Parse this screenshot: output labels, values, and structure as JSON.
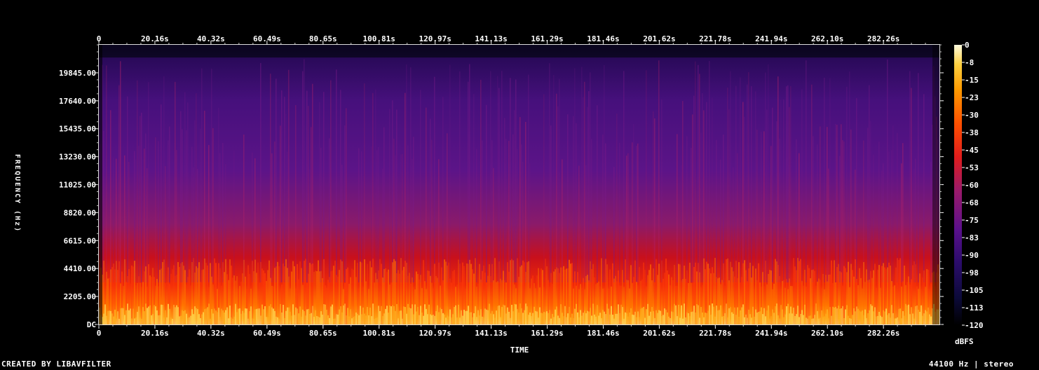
{
  "chart_data": {
    "type": "heatmap",
    "title": "",
    "xlabel": "TIME",
    "ylabel": "FREQUENCY (Hz)",
    "x_tick_labels": [
      "0",
      "20.16s",
      "40.32s",
      "60.49s",
      "80.65s",
      "100.81s",
      "120.97s",
      "141.13s",
      "161.29s",
      "181.46s",
      "201.62s",
      "221.78s",
      "241.94s",
      "262.10s",
      "282.26s"
    ],
    "x_ticks_seconds": [
      0,
      20.16,
      40.32,
      60.49,
      80.65,
      100.81,
      120.97,
      141.13,
      161.29,
      181.46,
      201.62,
      221.78,
      241.94,
      262.1,
      282.26
    ],
    "xlim": [
      0,
      302.4
    ],
    "y_tick_labels": [
      "DC",
      "2205.00",
      "4410.00",
      "6615.00",
      "8820.00",
      "11025.00",
      "13230.00",
      "15435.00",
      "17640.00",
      "19845.00"
    ],
    "y_ticks_hz": [
      0,
      2205,
      4410,
      6615,
      8820,
      11025,
      13230,
      15435,
      17640,
      19845
    ],
    "ylim": [
      0,
      22050
    ],
    "colorbar": {
      "label": "dBFS",
      "tick_labels": [
        "0",
        "-8",
        "-15",
        "-23",
        "-30",
        "-38",
        "-45",
        "-53",
        "-60",
        "-68",
        "-75",
        "-83",
        "-90",
        "-98",
        "-105",
        "-113",
        "-120"
      ],
      "range": [
        -120,
        0
      ]
    },
    "colormap": [
      "#000000",
      "#1a0a4a",
      "#3c0a78",
      "#5a108c",
      "#8a1a7a",
      "#c01a3a",
      "#e82010",
      "#ff5a00",
      "#ff9a00",
      "#ffd040",
      "#fff8c8"
    ]
  },
  "footer": {
    "credit": "CREATED BY LIBAVFILTER",
    "format": "44100 Hz | stereo"
  }
}
